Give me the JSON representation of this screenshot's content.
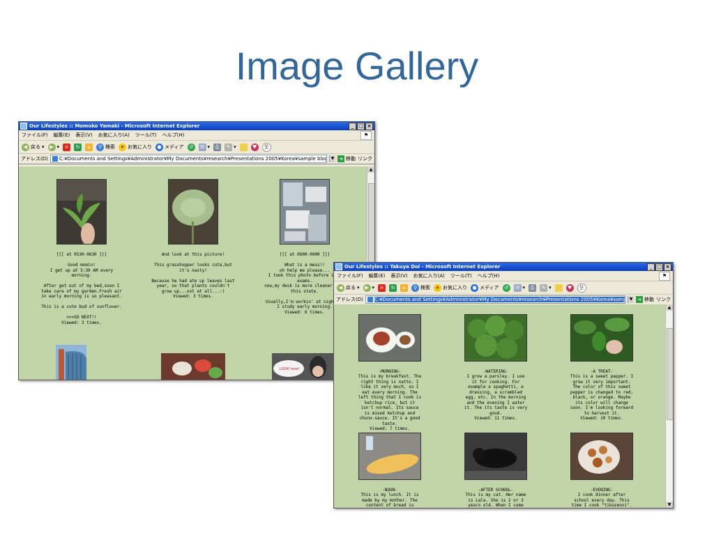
{
  "slide": {
    "title": "Image Gallery"
  },
  "window1": {
    "title": "Our Lifestyles :: Momoko Yamaki - Microsoft Internet Explorer",
    "menu": [
      "ファイル(F)",
      "編集(E)",
      "表示(V)",
      "お気に入り(A)",
      "ツール(T)",
      "ヘルプ(H)"
    ],
    "toolbar": {
      "back": "戻る",
      "search": "検索",
      "favorites": "お気に入り",
      "media": "メディア"
    },
    "address_label": "アドレス(D)",
    "address": "C:¥Documents and Settings¥Administrator¥My Documents¥research¥Presentations 2005¥Korea¥sample blogs¥Our Lifestyle",
    "go": "移動",
    "links": "リンク",
    "cells": [
      {
        "heading": "[[[ at 0530-0630 ]]]",
        "body": "Good momin!\nI get up at 5:30 AM every morning.\n\nAfter get out of my bed,soon I take care of my garden.Fresh air in early morning is so pleasant.\n\nThis is a cute bud of sunflover.\n\n>>>GO NEXT!!",
        "views": "Viewed: 3 times."
      },
      {
        "heading": "And look at this picture!",
        "body": "This grasshopper looks cute,but it's nasty!\n\nBecause he had ate up leaves last year, so that plants couldn't grow up...not at all...:(",
        "views": "Viewed: 3 times."
      },
      {
        "heading": "[[[ at 0600-0900 ]]]",
        "body": "What is a mess!!\noh help me please...\nI took this photo before 1Q's exams.\nnow,my desk is more cleaner than this state.\n\nUsually,I'm workin' at night,so\nI study early morning.",
        "views": "Viewed: 6 times."
      }
    ],
    "bottom_sign": "LOOK here!"
  },
  "window2": {
    "title": "Our Lifestyles :: Takuya Doi - Microsoft Internet Explorer",
    "menu": [
      "ファイル(F)",
      "編集(E)",
      "表示(V)",
      "お気に入り(A)",
      "ツール(T)",
      "ヘルプ(H)"
    ],
    "toolbar": {
      "back": "戻る",
      "search": "検索",
      "favorites": "お気に入り",
      "media": "メディア"
    },
    "address_label": "アドレス(D)",
    "address": "C:¥Documents and Settings¥Administrator¥My Documents¥research¥Presentations 2005¥Korea¥sample blogs¥Our Lifestyle",
    "go": "移動",
    "links": "リンク",
    "cells": [
      {
        "heading": "-MORNING-",
        "body": "This is my breakfast. The right thing is natto. I like it very much, so I eat every morning. The left thing that I cook is ketchup rice, but it isn't normal. Its sauce is mixed ketchup and chuno-sauce. It's a good taste.",
        "views": "Viewed: 7 times."
      },
      {
        "heading": "-WATERING-",
        "body": "I grow a parsley. I use it for cooking. For example a spaghetti, a dressing, a scrambled egg, etc. In the morning and the evening I water it. The its taste is very good.",
        "views": "Viewed: 11 times."
      },
      {
        "heading": "-A TREAT-",
        "body": "This is a sweet pepper. I grow it very important. The color of this sweet pepper is changed to red, black, or orange. Maybe its color will change soon. I'm looking forward to harvest it.",
        "views": "Viewed: 10 times."
      },
      {
        "heading": "-NOON-",
        "body": "This is my lunch. It is made by my mother. The content of bread is",
        "views": ""
      },
      {
        "heading": "-AFTER SCHOOL-",
        "body": "This is my cat. Her name is Lala. She is 2 or 3 years old. When I come",
        "views": ""
      },
      {
        "heading": "-EVENING-",
        "body": "I cook dinner after school every day. This time I cook \"tikuzenni\". These",
        "views": ""
      }
    ]
  }
}
